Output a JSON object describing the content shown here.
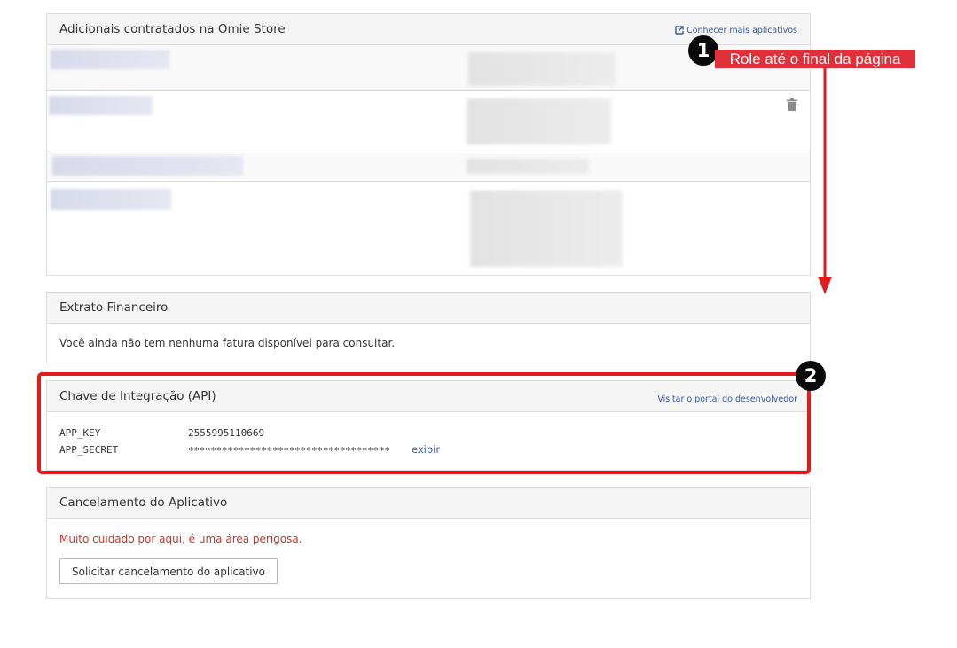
{
  "addons_panel": {
    "title": "Adicionais contratados na Omie Store",
    "link_label": "Conhecer mais aplicativos",
    "link_icon": "external-link-icon",
    "row_action_icon": "trash-icon"
  },
  "statement_panel": {
    "title": "Extrato Financeiro",
    "message": "Você ainda não tem nenhuma fatura disponível para consultar."
  },
  "api_panel": {
    "title": "Chave de Integração (API)",
    "link_label": "Visitar o portal do desenvolvedor",
    "app_key_label": "APP_KEY",
    "app_key_value": "2555995110669",
    "app_secret_label": "APP_SECRET",
    "app_secret_value": "************************************",
    "show_label": "exibir"
  },
  "cancel_panel": {
    "title": "Cancelamento do Aplicativo",
    "warning": "Muito cuidado por aqui, é uma área perigosa.",
    "button_label": "Solicitar cancelamento do aplicativo"
  },
  "annotations": {
    "step1_number": "1",
    "step1_text": "Role até o final da página",
    "step2_number": "2",
    "accent_color": "#e21b1b"
  }
}
